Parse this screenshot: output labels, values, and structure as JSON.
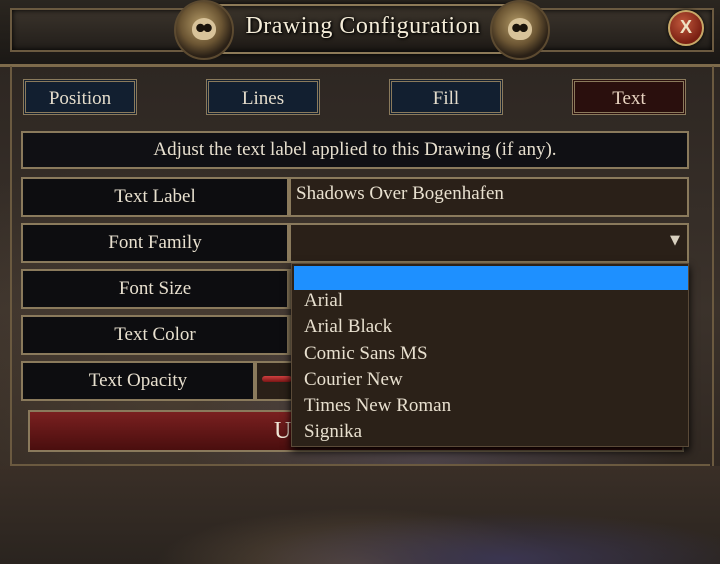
{
  "window": {
    "title": "Drawing Configuration",
    "close_label": "X"
  },
  "tabs": [
    {
      "label": "Position",
      "active": false
    },
    {
      "label": "Lines",
      "active": false
    },
    {
      "label": "Fill",
      "active": false
    },
    {
      "label": "Text",
      "active": true
    }
  ],
  "description": "Adjust the text label applied to this Drawing (if any).",
  "fields": {
    "text_label": {
      "label": "Text Label",
      "value": "Shadows Over Bogenhafen"
    },
    "font_family": {
      "label": "Font Family",
      "value": ""
    },
    "font_size": {
      "label": "Font Size"
    },
    "text_color": {
      "label": "Text Color"
    },
    "text_opacity": {
      "label": "Text Opacity"
    }
  },
  "font_family_options": [
    "",
    "Arial",
    "Arial Black",
    "Comic Sans MS",
    "Courier New",
    "Times New Roman",
    "Signika"
  ],
  "update_button": {
    "visible_text": "U"
  },
  "colors": {
    "tab_inactive": "#121f30",
    "tab_active": "#2a0f0d",
    "dropdown_highlight": "#1e90ff",
    "update_button": "#7a2020"
  },
  "icons": {
    "close": "close-icon",
    "dropdown_arrow": "chevron-down-icon",
    "header_ornament": "skull-icon"
  }
}
